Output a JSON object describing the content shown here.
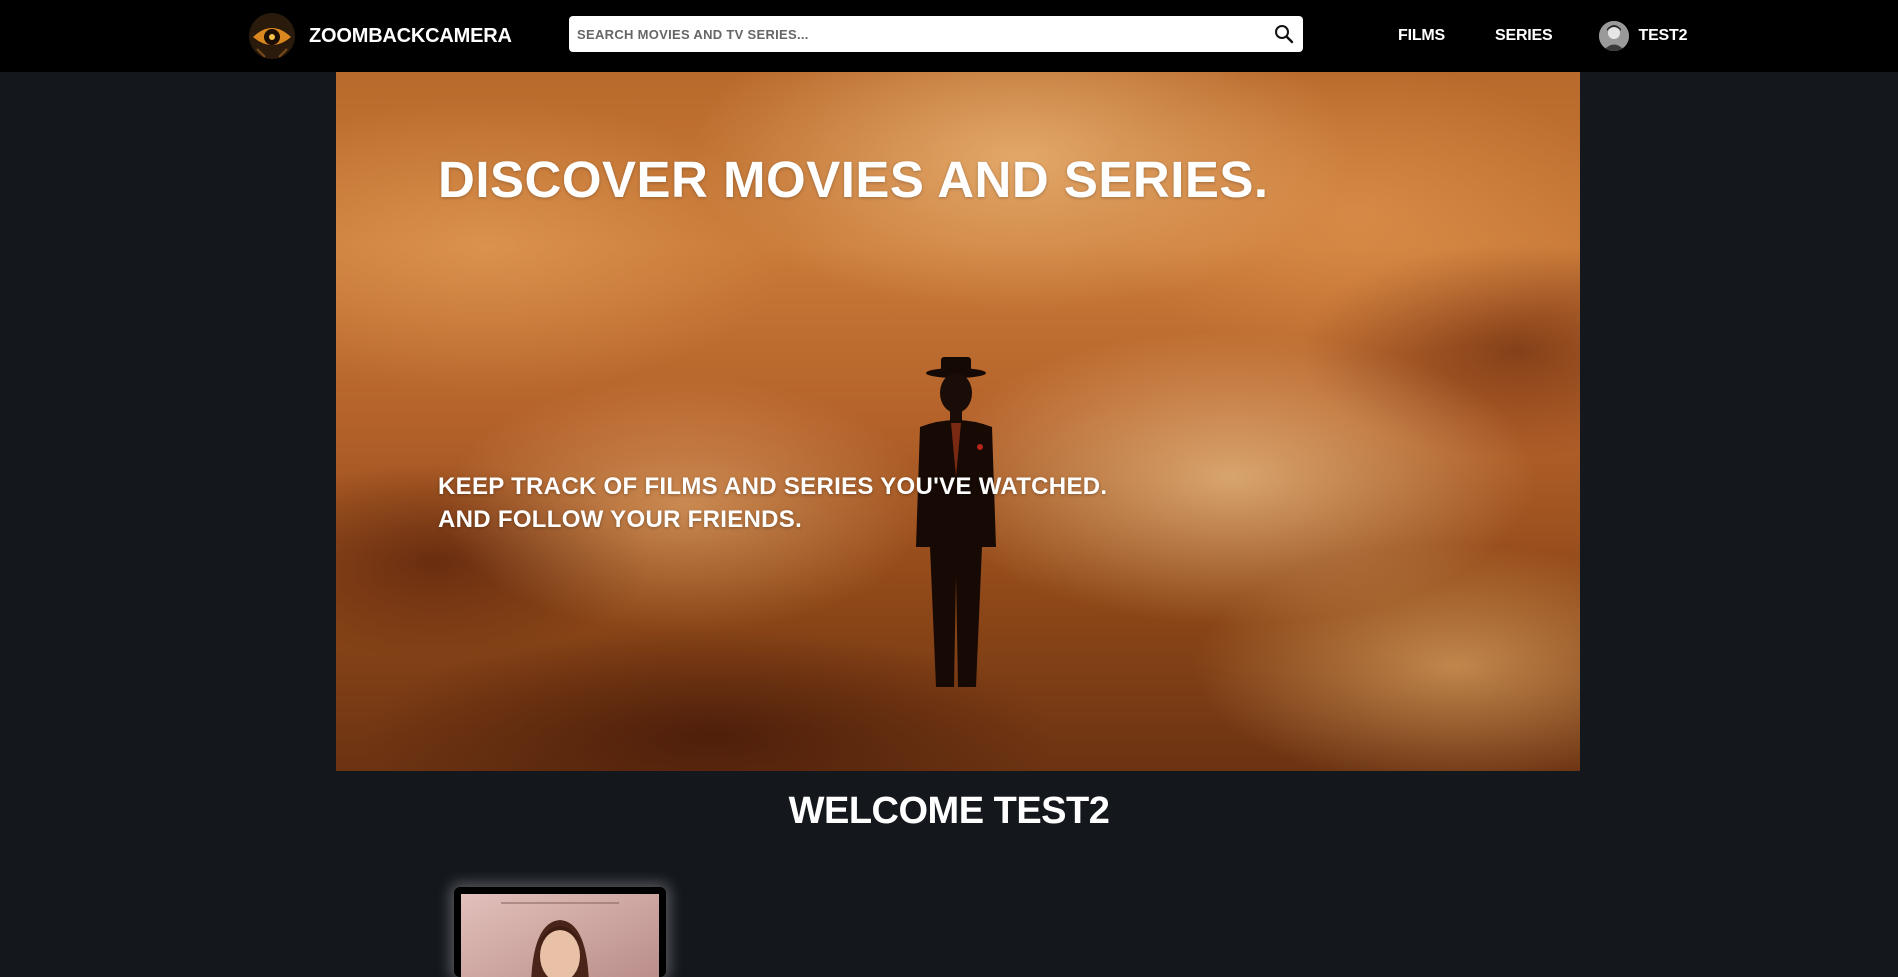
{
  "navbar": {
    "brand_name": "ZOOMBACKCAMERA",
    "logo_icon": "eye-icon",
    "search_placeholder": "SEARCH MOVIES AND TV SERIES...",
    "search_value": "",
    "search_icon": "search-icon",
    "links": {
      "films": "FILMS",
      "series": "SERIES"
    },
    "user": {
      "name": "TEST2",
      "avatar_icon": "avatar"
    }
  },
  "hero": {
    "title": "DISCOVER MOVIES AND SERIES.",
    "subtitle_line1": "KEEP TRACK OF FILMS AND SERIES YOU'VE WATCHED.",
    "subtitle_line2": "AND FOLLOW YOUR FRIENDS."
  },
  "welcome": {
    "text": "WELCOME TEST2"
  },
  "colors": {
    "page_background": "#14171c",
    "navbar_background": "#000000",
    "text": "#ffffff",
    "hero_tone": "#c97a38"
  }
}
